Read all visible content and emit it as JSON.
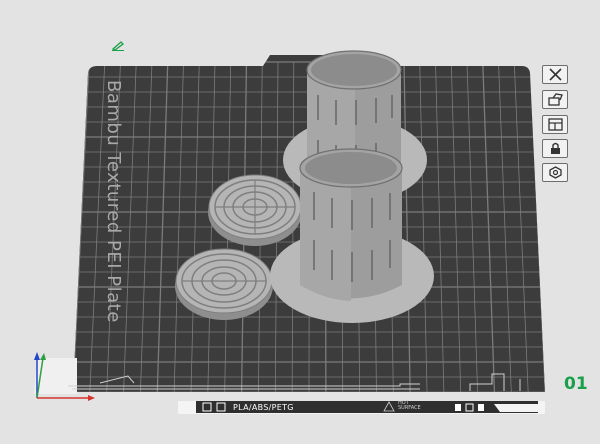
{
  "plate": {
    "title": "Bambu Textured PEI Plate",
    "number": "01",
    "filament": "PLA/ABS/PETG",
    "surface_warning_line1": "HOT",
    "surface_warning_line2": "SURFACE"
  },
  "toolbar": [
    {
      "name": "close-plate",
      "icon": "close-icon"
    },
    {
      "name": "auto-orient",
      "icon": "orient-icon"
    },
    {
      "name": "arrange",
      "icon": "arrange-icon"
    },
    {
      "name": "lock-plate",
      "icon": "lock-icon"
    },
    {
      "name": "plate-settings",
      "icon": "gear-icon"
    }
  ],
  "colors": {
    "background": "#e2e3e2",
    "plate": "#3b3c3b",
    "grid": "#7b7c7b",
    "object": "#a8a9a8",
    "plate_number": "#1aa04a",
    "axis_x": "#d4342e",
    "axis_y": "#2ea043",
    "axis_z": "#2445c8"
  }
}
